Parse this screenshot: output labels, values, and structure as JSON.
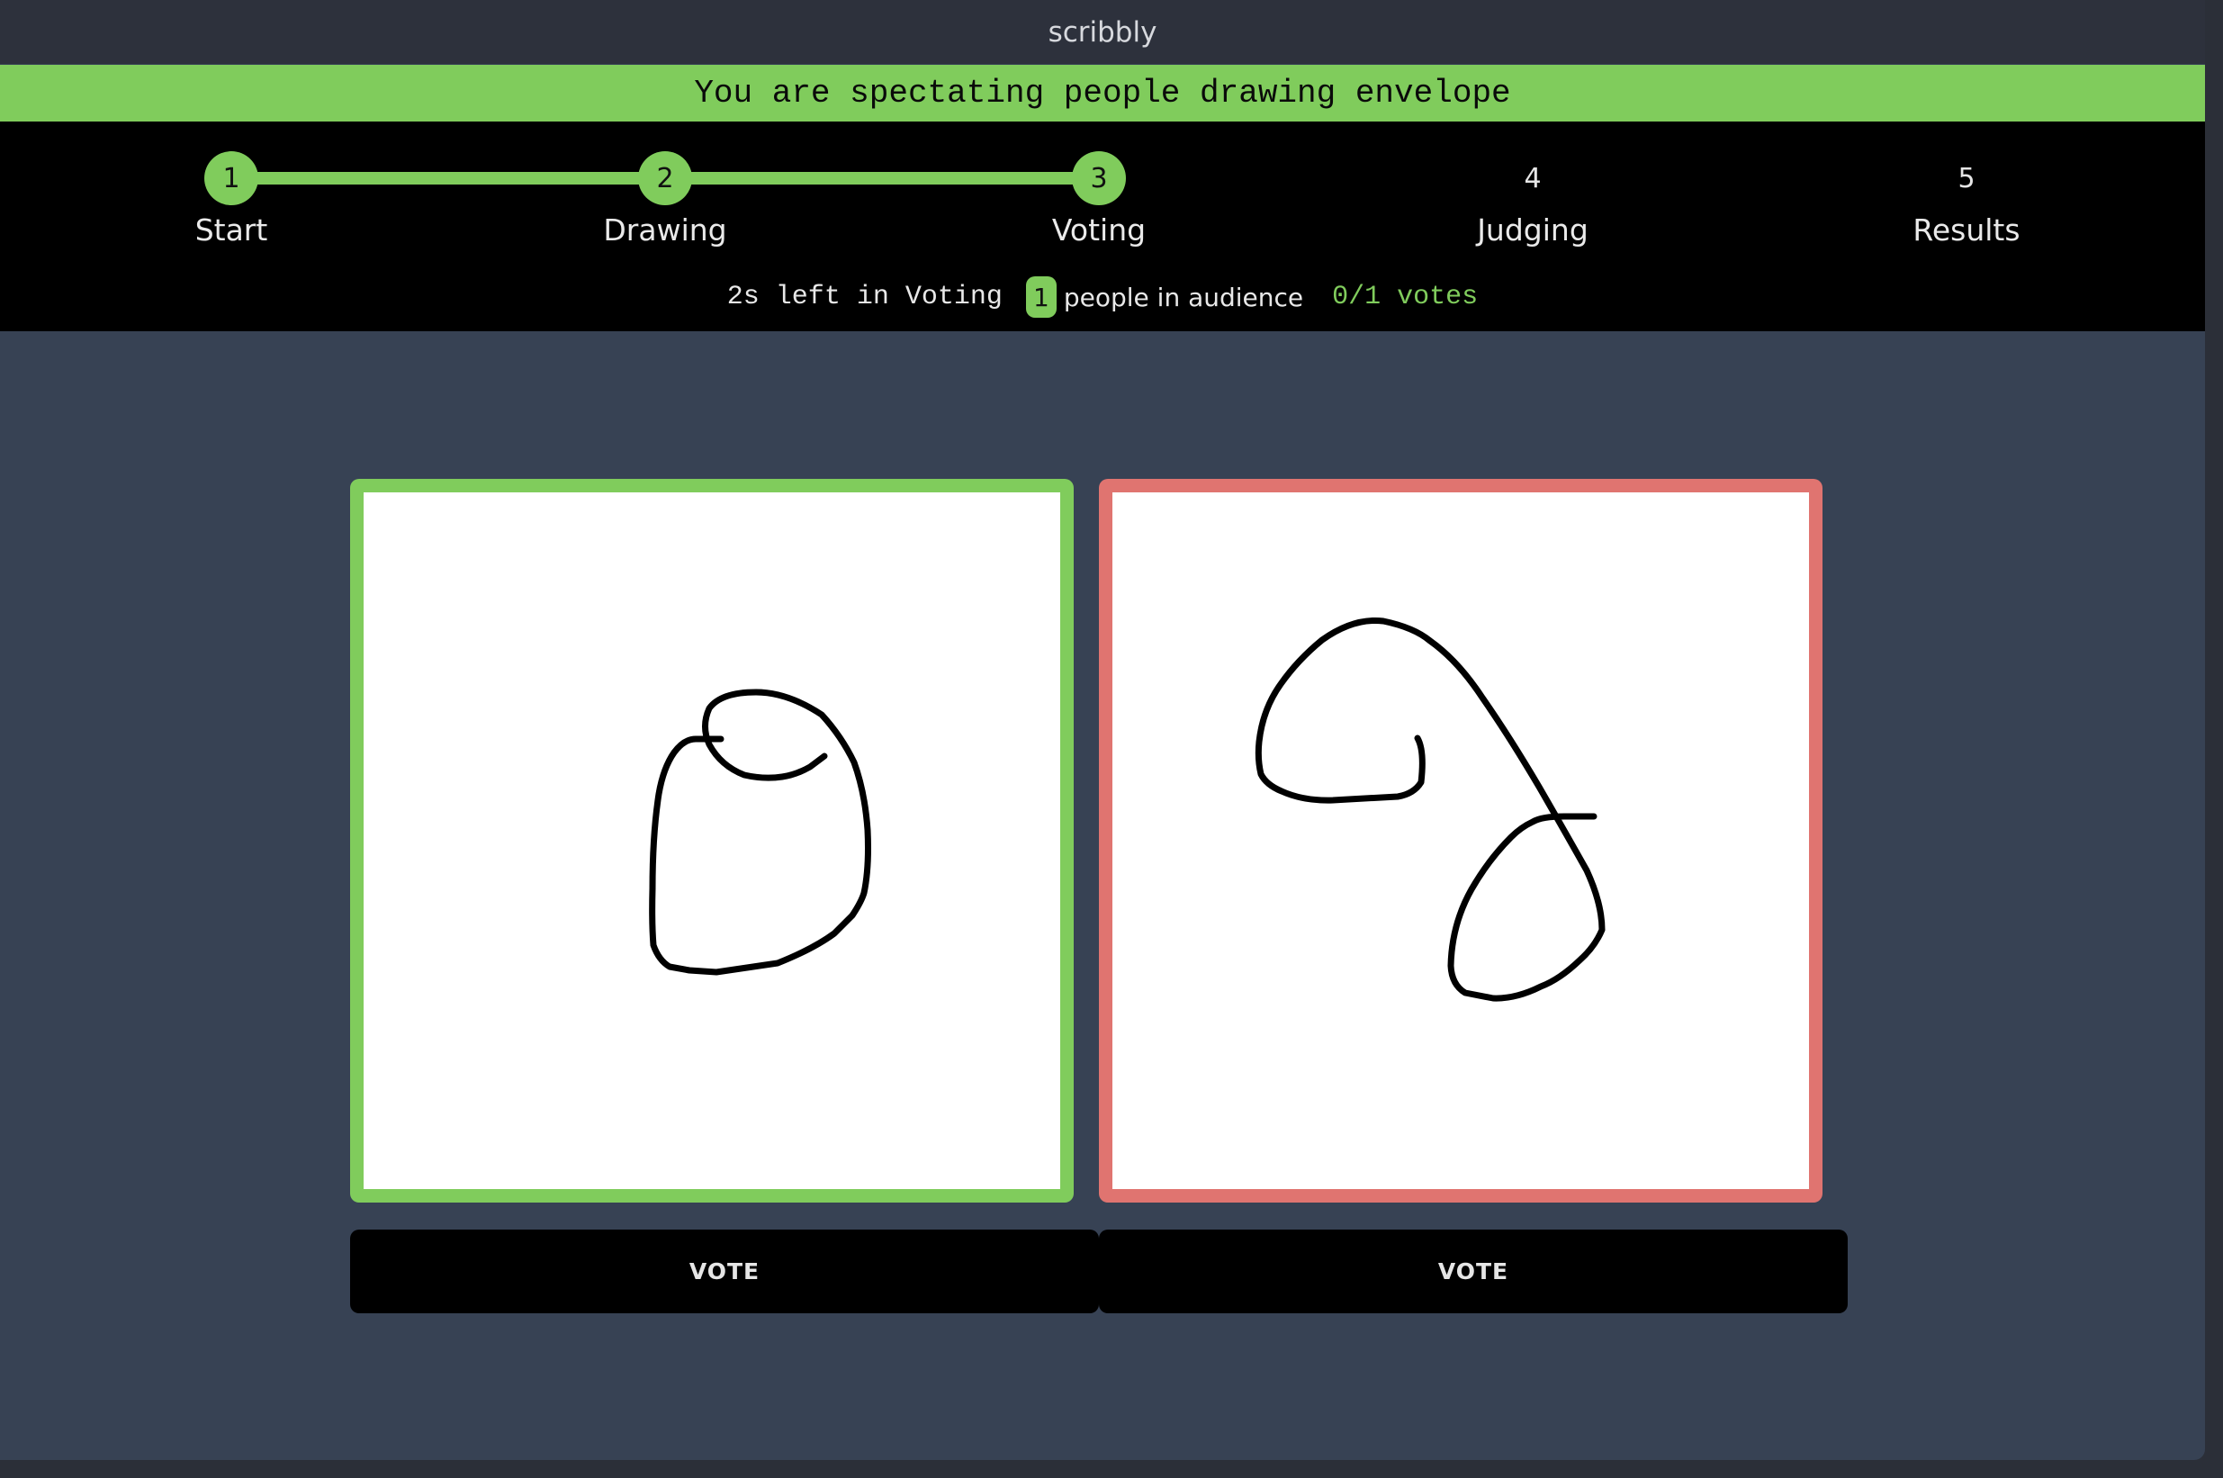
{
  "app": {
    "title": "scribbly"
  },
  "banner": {
    "text": "You are spectating people drawing envelope"
  },
  "steps": [
    {
      "number": "1",
      "label": "Start",
      "state": "done"
    },
    {
      "number": "2",
      "label": "Drawing",
      "state": "done"
    },
    {
      "number": "3",
      "label": "Voting",
      "state": "current"
    },
    {
      "number": "4",
      "label": "Judging",
      "state": "todo"
    },
    {
      "number": "5",
      "label": "Results",
      "state": "todo"
    }
  ],
  "status": {
    "time_left": "2s left in Voting",
    "audience_count": "1",
    "audience_label": "people in audience",
    "votes": "0/1 votes"
  },
  "drawings": [
    {
      "border_color": "#80cc5c",
      "vote_label": "VOTE"
    },
    {
      "border_color": "#e07470",
      "vote_label": "VOTE"
    }
  ],
  "colors": {
    "accent_green": "#80cc5c",
    "accent_red": "#e07470",
    "background": "#374254"
  }
}
